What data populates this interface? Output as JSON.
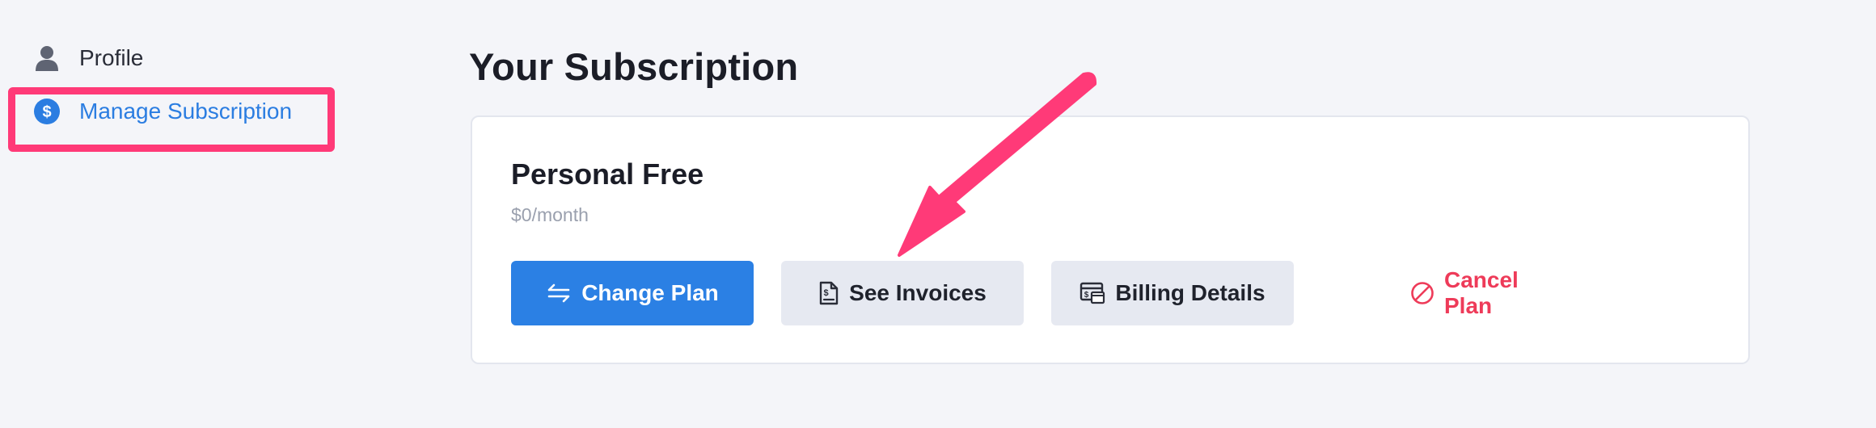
{
  "sidebar": {
    "items": [
      {
        "label": "Profile",
        "icon": "user-icon",
        "active": false
      },
      {
        "label": "Manage Subscription",
        "icon": "dollar-circle-icon",
        "active": true
      }
    ]
  },
  "main": {
    "title": "Your Subscription",
    "plan": {
      "name": "Personal Free",
      "price": "$0/month"
    },
    "buttons": {
      "change_plan": "Change Plan",
      "see_invoices": "See Invoices",
      "billing_details": "Billing Details",
      "cancel_plan": "Cancel Plan"
    }
  },
  "colors": {
    "accent": "#2b80e4",
    "danger": "#ee3b59",
    "annotation": "#ff3a78",
    "background": "#f4f5f9",
    "secondary_button": "#e6e9f1"
  }
}
